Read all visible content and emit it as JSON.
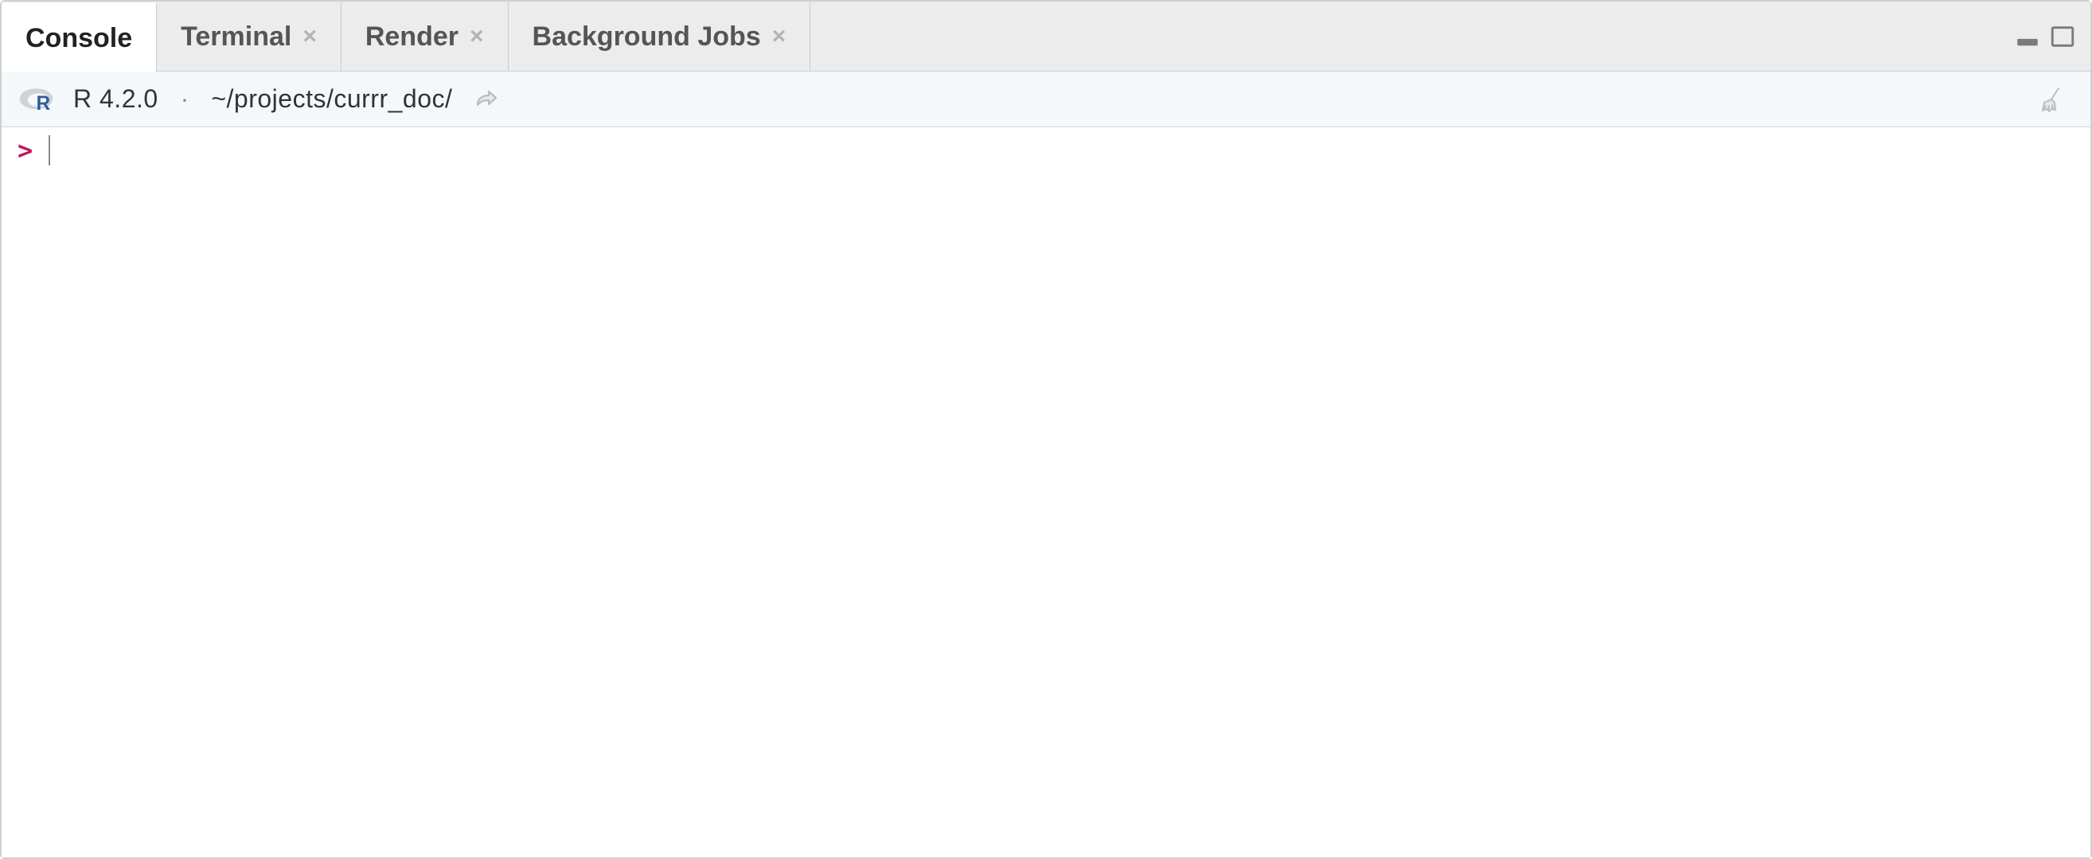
{
  "tabs": [
    {
      "label": "Console",
      "closable": false,
      "active": true
    },
    {
      "label": "Terminal",
      "closable": true,
      "active": false
    },
    {
      "label": "Render",
      "closable": true,
      "active": false
    },
    {
      "label": "Background Jobs",
      "closable": true,
      "active": false
    }
  ],
  "info": {
    "r_version": "R 4.2.0",
    "separator": "·",
    "working_dir": "~/projects/currr_doc/"
  },
  "console": {
    "prompt": ">"
  },
  "icons": {
    "close": "×"
  }
}
